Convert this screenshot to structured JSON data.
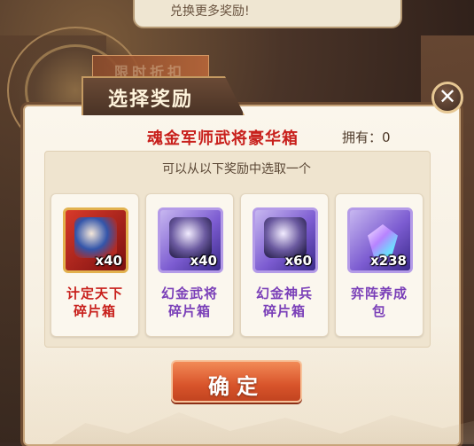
{
  "background": {
    "bubble_text": "兑换更多奖励!",
    "strip_text": "限时折扣"
  },
  "dialog": {
    "title": "选择奖励",
    "close_icon": "close-x-icon",
    "box_name": "魂金军师武将豪华箱",
    "owned_label": "拥有：0",
    "hint": "可以从以下奖励中选取一个",
    "confirm_label": "确定"
  },
  "rewards": [
    {
      "name": "计定天下\n碎片箱",
      "qty": "x40",
      "frame": "red",
      "label_color": "#c8201c"
    },
    {
      "name": "幻金武将\n碎片箱",
      "qty": "x40",
      "frame": "purple",
      "label_color": "#7a3fb8"
    },
    {
      "name": "幻金神兵\n碎片箱",
      "qty": "x60",
      "frame": "purple",
      "label_color": "#7a3fb8"
    },
    {
      "name": "弈阵养成\n包",
      "qty": "x238",
      "frame": "purple",
      "label_color": "#7a3fb8"
    }
  ]
}
